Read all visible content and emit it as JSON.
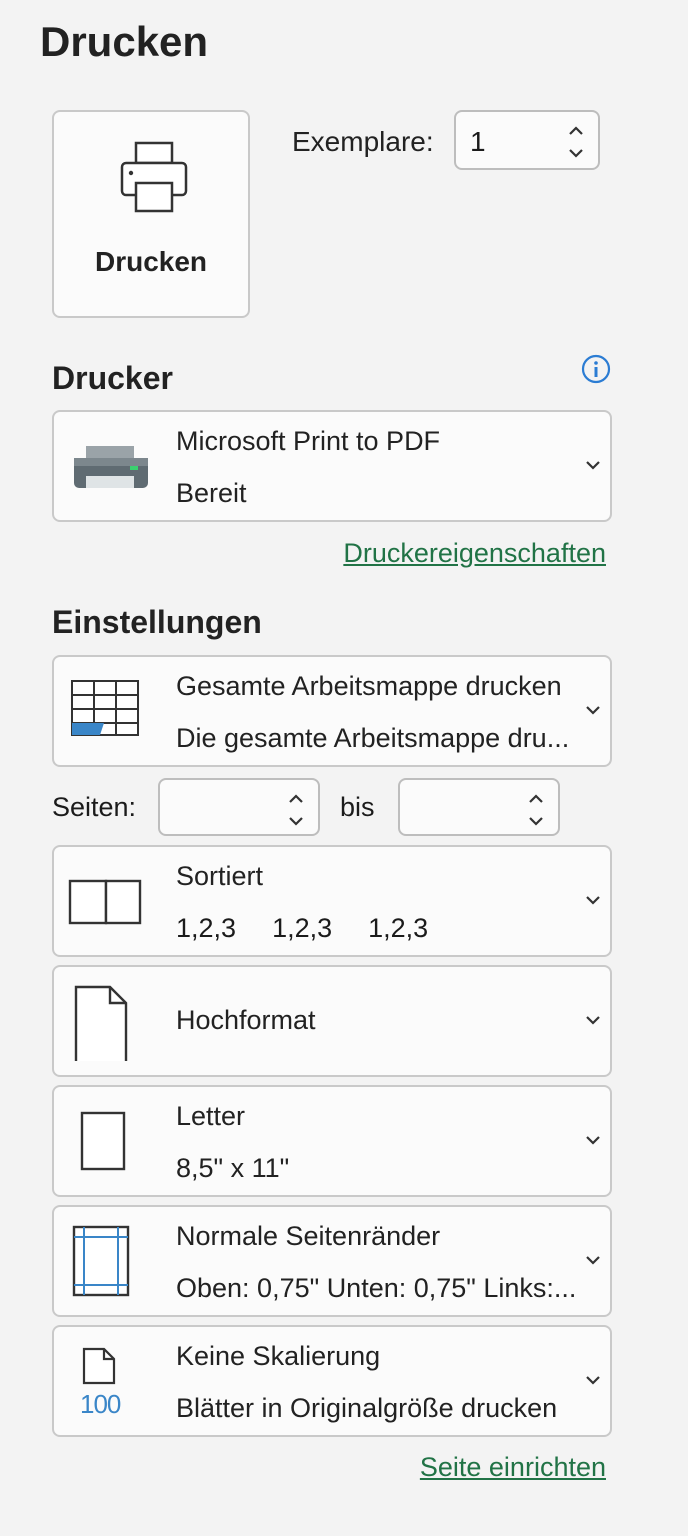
{
  "page_title": "Drucken",
  "print_button": {
    "label": "Drucken",
    "icon": "printer-icon"
  },
  "copies": {
    "label": "Exemplare:",
    "value": "1"
  },
  "printer_section": {
    "title": "Drucker",
    "printer_name": "Microsoft Print to PDF",
    "status": "Bereit",
    "properties_link": "Druckereigenschaften"
  },
  "settings_section": {
    "title": "Einstellungen",
    "scope": {
      "line1": "Gesamte Arbeitsmappe drucken",
      "line2": "Die gesamte Arbeitsmappe dru..."
    },
    "pages": {
      "label": "Seiten:",
      "to_label": "bis",
      "from_value": "",
      "to_value": ""
    },
    "collation": {
      "line1": "Sortiert",
      "values": [
        "1,2,3",
        "1,2,3",
        "1,2,3"
      ]
    },
    "orientation": {
      "label": "Hochformat"
    },
    "paper": {
      "line1": "Letter",
      "line2": "8,5\" x 11\""
    },
    "margins": {
      "line1": "Normale Seitenränder",
      "line2": "Oben: 0,75\" Unten: 0,75\" Links:..."
    },
    "scaling": {
      "line1": "Keine Skalierung",
      "line2": "Blätter in Originalgröße drucken",
      "icon_text": "100"
    },
    "page_setup_link": "Seite einrichten"
  },
  "colors": {
    "accent_link": "#217346",
    "info_blue": "#2b7cd3",
    "grid_blue": "#3a86c8"
  }
}
